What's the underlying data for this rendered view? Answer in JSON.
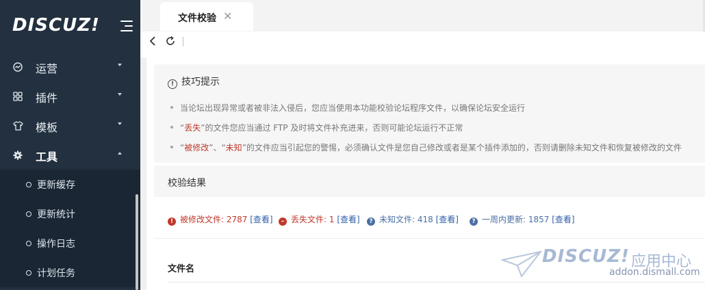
{
  "sidebar": {
    "logo": "DISCUZ!",
    "menu": [
      {
        "label": "运营",
        "icon": "speedometer-icon",
        "expanded": false
      },
      {
        "label": "插件",
        "icon": "grid-icon",
        "expanded": false
      },
      {
        "label": "模板",
        "icon": "shirt-icon",
        "expanded": false
      },
      {
        "label": "工具",
        "icon": "gear-icon",
        "expanded": true
      }
    ],
    "submenu": [
      {
        "label": "更新缓存"
      },
      {
        "label": "更新统计"
      },
      {
        "label": "操作日志"
      },
      {
        "label": "计划任务"
      }
    ]
  },
  "tabs": [
    {
      "label": "文件校验",
      "close": "✕"
    }
  ],
  "tips": {
    "title": "技巧提示",
    "line1": "当论坛出现异常或者被非法入侵后，您应当使用本功能校验论坛程序文件，以确保论坛安全运行",
    "line2_q1": "“",
    "line2_red": "丢失",
    "line2_rest": "”的文件您应当通过 FTP 及时将文件补充进来，否则可能论坛运行不正常",
    "line3_q1": "“",
    "line3_red1": "被修改",
    "line3_mid": "”、“",
    "line3_red2": "未知",
    "line3_rest": "”的文件应当引起您的警惕，必须确认文件是您自己修改或者是某个插件添加的，否则请删除未知文件和恢复被修改的文件"
  },
  "result": {
    "title": "校验结果",
    "stats": [
      {
        "label": "被修改文件: 2787",
        "link": "[查看]",
        "color": "#c0392b",
        "icon": "!",
        "icon_name": "exclamation-circle-icon"
      },
      {
        "label": "丢失文件: 1",
        "link": "[查看]",
        "color": "#c0392b",
        "icon": "–",
        "icon_name": "minus-circle-icon"
      },
      {
        "label": "未知文件: 418",
        "link": "[查看]",
        "color": "#4a6fa5",
        "icon": "?",
        "icon_name": "question-circle-icon"
      },
      {
        "label": "一周内更新: 1857",
        "link": "[查看]",
        "color": "#4a6fa5",
        "icon": "?",
        "icon_name": "question-circle-icon"
      }
    ]
  },
  "table": {
    "header": "文件名"
  },
  "watermark": {
    "logo": "DISCUZ!",
    "text": "应用中心",
    "url": "addon.dismall.com"
  }
}
